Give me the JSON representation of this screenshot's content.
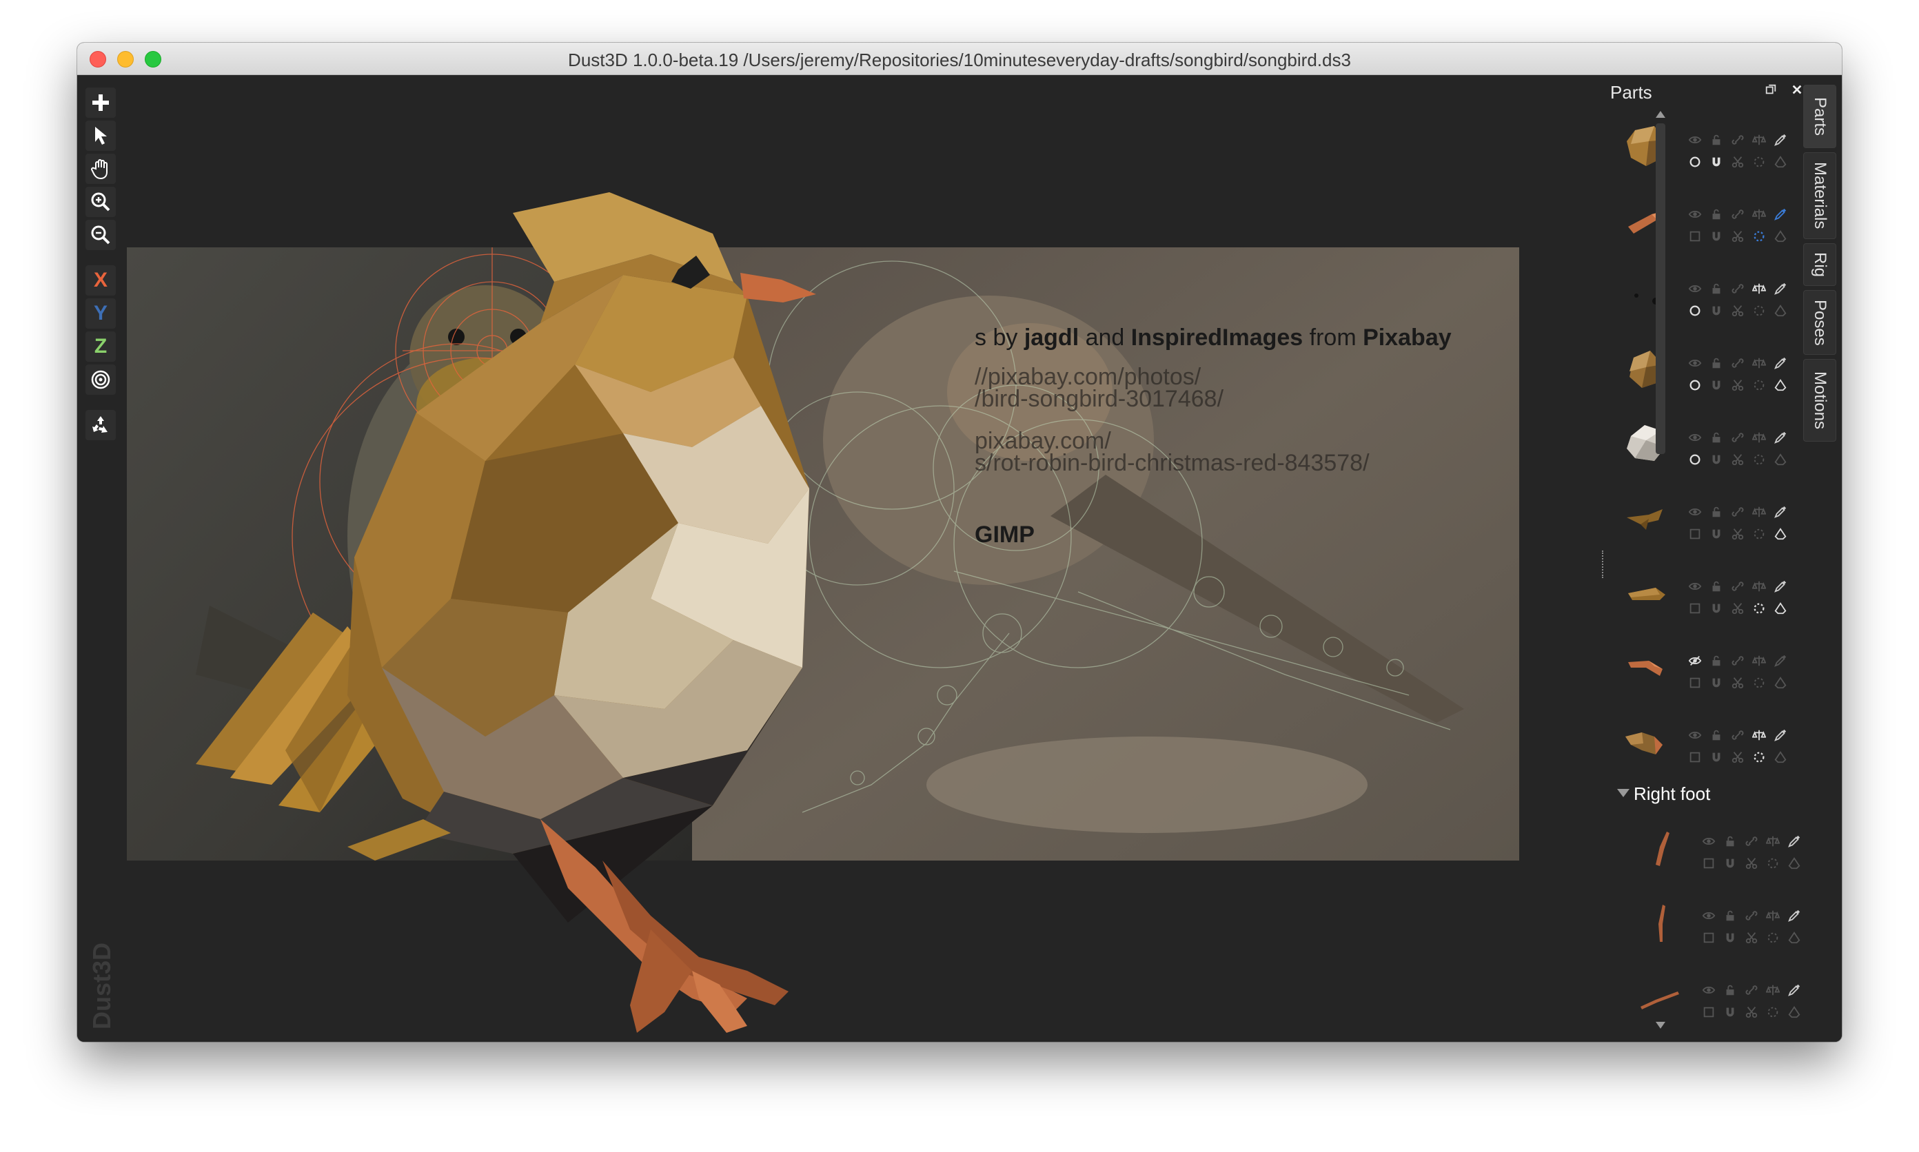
{
  "window": {
    "title": "Dust3D 1.0.0-beta.19 /Users/jeremy/Repositories/10minuteseveryday-drafts/songbird/songbird.ds3"
  },
  "toolbar": {
    "tools": [
      "add-icon",
      "select-icon",
      "pan-icon",
      "zoom-in-icon",
      "zoom-out-icon"
    ],
    "axes": [
      {
        "label": "X",
        "color": "#e8643c"
      },
      {
        "label": "Y",
        "color": "#3d6fb6"
      },
      {
        "label": "Z",
        "color": "#8ad16b"
      }
    ],
    "extra": [
      "radial-mode-icon",
      "recycle-icon"
    ]
  },
  "watermark": "Dust3D",
  "reference_credits": {
    "line1_pre": "s by ",
    "user1": "jagdl",
    "line1_mid": " and ",
    "user2": "InspiredImages",
    "line1_post": " from ",
    "site": "Pixabay",
    "url1_a": "//pixabay.com/photos/",
    "url1_b": "/bird-songbird-3017468/",
    "url2_a": "pixabay.com/",
    "url2_b": "s/rot-robin-bird-christmas-red-843578/",
    "tool": "GIMP"
  },
  "parts_panel": {
    "title": "Parts",
    "group_name": "Right foot",
    "accent": "#3a7bd5"
  },
  "tabs": [
    "Parts",
    "Materials",
    "Rig",
    "Poses",
    "Motions"
  ]
}
